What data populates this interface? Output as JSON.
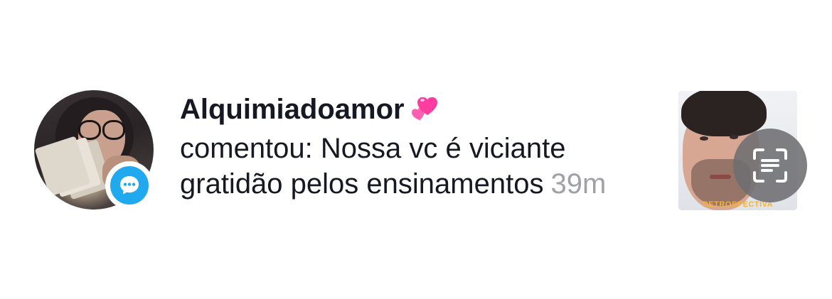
{
  "notification": {
    "username": "Alquimiadoamor",
    "username_emoji_icon": "two-hearts-icon",
    "action_text": "comentou: Nossa vc é viciante",
    "comment_continued": "gratidão pelos ensinamentos",
    "timestamp": "39m",
    "badge_icon": "comment-bubble-icon",
    "badge_color": "#21a9f0",
    "thumbnail_caption": "RETROSPECTIVA",
    "thumbnail_caption_color": "#f3b33a",
    "scan_icon": "scan-text-icon"
  },
  "colors": {
    "text": "#161823",
    "timestamp": "#a0a1a7",
    "background": "#ffffff"
  }
}
